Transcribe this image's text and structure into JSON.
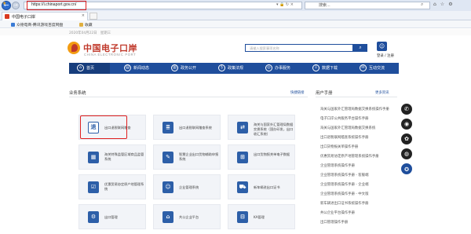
{
  "browser": {
    "back_glyph": "←",
    "fwd_glyph": "→",
    "url": "https://i.chinaport.gov.cn/",
    "url_tools": "▾ 🔒 ↻ ×",
    "search_placeholder": "搜索...",
    "search_icon": "magnifier-icon",
    "tab_title": "中国电子口岸",
    "favorites": [
      "众德电商-腾讯游戏百度网盘",
      "收藏"
    ]
  },
  "site": {
    "date": "2020年04月22日　星期三",
    "logo_cn": "中国电子口岸",
    "logo_en": "CHINA ELECTRONIC PORT",
    "search_placeholder": "请输入搜索事项名称",
    "login": "登录 / 注册",
    "nav": [
      {
        "label": "首页",
        "icon": "home-icon",
        "glyph": "⌂"
      },
      {
        "label": "新闻动态",
        "icon": "news-icon",
        "glyph": "▤"
      },
      {
        "label": "政务公开",
        "icon": "doc-icon",
        "glyph": "▥"
      },
      {
        "label": "政策法规",
        "icon": "law-icon",
        "glyph": "§"
      },
      {
        "label": "办事服务",
        "icon": "service-icon",
        "glyph": "◎"
      },
      {
        "label": "数据下载",
        "icon": "download-icon",
        "glyph": "⇩"
      },
      {
        "label": "互动交流",
        "icon": "chat-icon",
        "glyph": "✉"
      }
    ]
  },
  "main": {
    "business_title": "业务系统",
    "business_more": "快捷链接",
    "manual_title": "用户手册",
    "manual_more": "更多资讯",
    "cards": [
      {
        "label": "出口退税联网稽查",
        "glyph": "退"
      },
      {
        "label": "出口退税联网稽查系统",
        "glyph": "≣"
      },
      {
        "label": "海关与国家外汇管理局数据交换系统（国办印发，出口收汇系统）",
        "glyph": "⇄"
      },
      {
        "label": "海关特殊监管区域商品监管系统",
        "glyph": "▦"
      },
      {
        "label": "智慧企业出口货物辅助申报系统",
        "glyph": "✎"
      },
      {
        "label": "出口货物报关单电子数据",
        "glyph": "⊞"
      },
      {
        "label": "优惠贸易协定原产地管理系统",
        "glyph": "☑"
      },
      {
        "label": "企业管理系统",
        "glyph": "☺"
      },
      {
        "label": "新车辆进出口证书",
        "glyph": "⛟"
      },
      {
        "label": "出口管理",
        "glyph": "⚙"
      },
      {
        "label": "共公企业平台",
        "glyph": "⌂"
      },
      {
        "label": "KA管理",
        "glyph": "⊟"
      }
    ],
    "manual_items": [
      "海关与国家外汇管理局数据交换系统操作手册",
      "电子口岸公共服务平台操作手册",
      "海关与国家外汇管理局数据交换系统",
      "出口退税联网稽查系统操作手册",
      "出口货物报关单操作手册",
      "优惠贸易协定原产地管理系统操作手册",
      "企业管理系统操作手册",
      "企业管理系统操作手册 - 客服端",
      "企业管理系统操作手册 - 企业端",
      "企业管理系统操作手册 - 中文版",
      "新车辆进出口证书系统操作手册",
      "共公企业平台操作手册",
      "出口管理操作手册"
    ],
    "side_icons": [
      {
        "name": "whatsapp-icon",
        "glyph": "✆"
      },
      {
        "name": "qq-icon",
        "glyph": "◉"
      },
      {
        "name": "wechat-icon",
        "glyph": "✿"
      },
      {
        "name": "weibo-icon",
        "glyph": "◍"
      },
      {
        "name": "customs-logo-icon",
        "glyph": "✪"
      }
    ]
  }
}
